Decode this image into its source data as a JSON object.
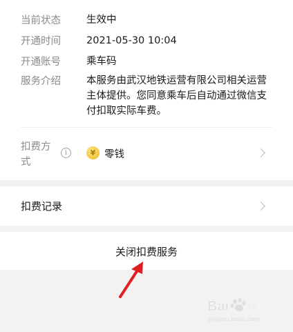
{
  "details": {
    "status_label": "当前状态",
    "status_value": "生效中",
    "open_time_label": "开通时间",
    "open_time_value": "2021-05-30 10:04",
    "account_label": "开通账号",
    "account_value": "乘车码",
    "service_intro_label": "服务介绍",
    "service_intro_value": "本服务由武汉地铁运营有限公司相关运营主体提供。您同意乘车后自动通过微信支付扣取实际车费。"
  },
  "payment_method": {
    "label": "扣费方式",
    "info_icon": "info-icon",
    "value_icon": "coin-icon",
    "value": "零钱"
  },
  "records": {
    "label": "扣费记录"
  },
  "close_service": {
    "label": "关闭扣费服务"
  },
  "annotation": {
    "arrow_color": "#e02020"
  },
  "watermark": {
    "brand": "Bai",
    "brand_suffix": "百度经验",
    "sub": "jingyan.baidu.com"
  }
}
